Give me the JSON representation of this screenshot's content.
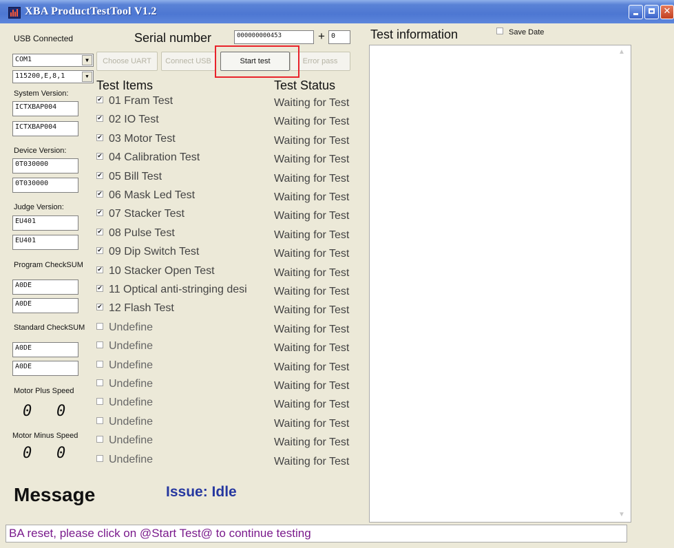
{
  "window": {
    "title": "XBA ProductTestTool V1.2"
  },
  "left_panel": {
    "usb_status": "USB Connected",
    "com_port": "COM1",
    "uart_settings": "115200,E,8,1",
    "system_version_label": "System Version:",
    "system_version_1": "ICTXBAP004",
    "system_version_2": "ICTXBAP004",
    "device_version_label": "Device Version:",
    "device_version_1": "0T030000",
    "device_version_2": "0T030000",
    "judge_version_label": "Judge Version:",
    "judge_version_1": "EU401",
    "judge_version_2": "EU401",
    "program_checksum_label": "Program CheckSUM",
    "program_checksum_1": "A0DE",
    "program_checksum_2": "A0DE",
    "standard_checksum_label": "Standard CheckSUM",
    "standard_checksum_1": "A0DE",
    "standard_checksum_2": "A0DE",
    "motor_plus_label": "Motor Plus Speed",
    "motor_plus_1": "0",
    "motor_plus_2": "0",
    "motor_minus_label": "Motor Minus Speed",
    "motor_minus_1": "0",
    "motor_minus_2": "0"
  },
  "serial": {
    "label": "Serial number",
    "value": "000000000453",
    "plus_label": "+",
    "increment": "0"
  },
  "toolbar": {
    "choose_uart": "Choose UART",
    "connect_usb": "Connect USB",
    "start_test": "Start test",
    "error_pass": "Error pass"
  },
  "tests": {
    "items_header": "Test Items",
    "status_header": "Test Status",
    "items": [
      {
        "name": "01 Fram Test",
        "checked": true,
        "status": "Waiting for Test"
      },
      {
        "name": "02 IO Test",
        "checked": true,
        "status": "Waiting for Test"
      },
      {
        "name": "03 Motor Test",
        "checked": true,
        "status": "Waiting for Test"
      },
      {
        "name": "04 Calibration Test",
        "checked": true,
        "status": "Waiting for Test"
      },
      {
        "name": "05 Bill Test",
        "checked": true,
        "status": "Waiting for Test"
      },
      {
        "name": "06 Mask Led Test",
        "checked": true,
        "status": "Waiting for Test"
      },
      {
        "name": "07 Stacker Test",
        "checked": true,
        "status": "Waiting for Test"
      },
      {
        "name": "08 Pulse Test",
        "checked": true,
        "status": "Waiting for Test"
      },
      {
        "name": "09 Dip Switch Test",
        "checked": true,
        "status": "Waiting for Test"
      },
      {
        "name": "10 Stacker Open Test",
        "checked": true,
        "status": "Waiting for Test"
      },
      {
        "name": "11 Optical anti-stringing desi",
        "checked": true,
        "status": "Waiting for Test"
      },
      {
        "name": "12 Flash Test",
        "checked": true,
        "status": "Waiting for Test"
      },
      {
        "name": "Undefine",
        "checked": false,
        "status": "Waiting for Test"
      },
      {
        "name": "Undefine",
        "checked": false,
        "status": "Waiting for Test"
      },
      {
        "name": "Undefine",
        "checked": false,
        "status": "Waiting for Test"
      },
      {
        "name": "Undefine",
        "checked": false,
        "status": "Waiting for Test"
      },
      {
        "name": "Undefine",
        "checked": false,
        "status": "Waiting for Test"
      },
      {
        "name": "Undefine",
        "checked": false,
        "status": "Waiting for Test"
      },
      {
        "name": "Undefine",
        "checked": false,
        "status": "Waiting for Test"
      },
      {
        "name": "Undefine",
        "checked": false,
        "status": "Waiting for Test"
      }
    ]
  },
  "info": {
    "title": "Test information",
    "save_date_label": "Save Date",
    "save_date_checked": false
  },
  "message": {
    "label": "Message",
    "issue": "Issue: Idle"
  },
  "status_bar": {
    "text": "BA reset, please click on @Start Test@ to continue testing"
  },
  "icons": {
    "check": "check-mark-icon",
    "combo_arrow": "chevron-down-icon"
  },
  "colors": {
    "titlebar": "#4d77d2",
    "highlight": "#e8222a",
    "issue": "#2638a0",
    "status_text": "#7a1a8c"
  }
}
